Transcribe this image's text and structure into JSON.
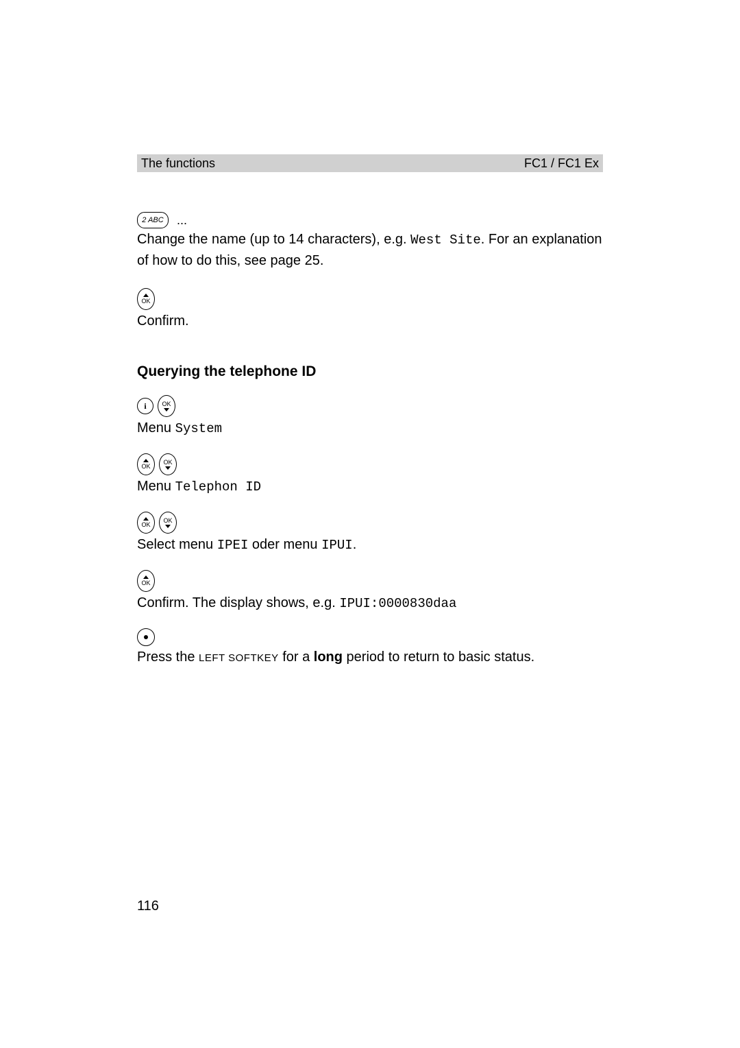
{
  "header": {
    "left": "The functions",
    "right": "FC1 / FC1 Ex"
  },
  "key2": {
    "label": "2 ABC"
  },
  "ellipsis": "...",
  "step_change_name": {
    "prefix": "Change the name (up to 14 characters), e.g. ",
    "mono": "West Site",
    "suffix1": ". For an explanation",
    "line2": "of how to do this, see page 25."
  },
  "ok_label": "OK",
  "confirm_text": "Confirm.",
  "subheading": "Querying the telephone ID",
  "i_label": "i",
  "menu_prefix": "Menu ",
  "menu_system": "System",
  "menu_telephon_id": "Telephon ID",
  "select_menu": {
    "prefix": "Select menu ",
    "ipei": "IPEI",
    "mid": " oder menu ",
    "ipui": "IPUI",
    "end": "."
  },
  "confirm_display": {
    "prefix": "Confirm. The display shows, e.g. ",
    "mono": "IPUI:0000830daa"
  },
  "final": {
    "prefix": "Press the ",
    "softkey": "LEFT SOFTKEY",
    "mid": " for a ",
    "long": "long",
    "suffix": " period to return to basic status."
  },
  "page_number": "116"
}
